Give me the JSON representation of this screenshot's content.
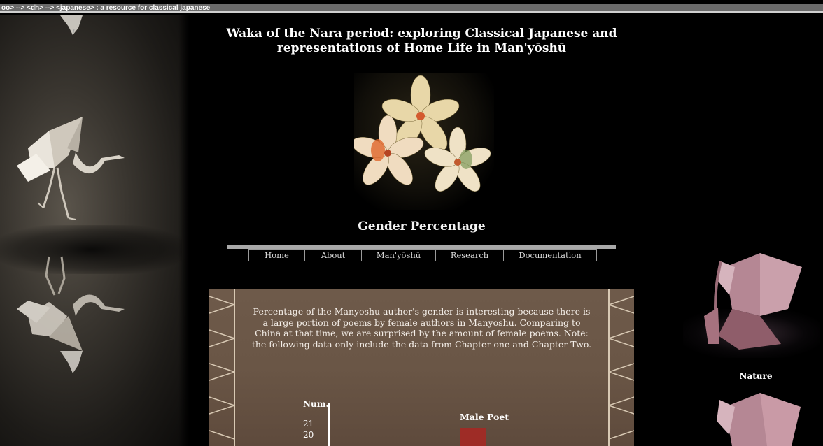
{
  "breadcrumb": "oo> --> <dh> --> <japanese> : a resource for classical japanese",
  "page_title": "Waka of the Nara period: exploring Classical Japanese and representations of Home Life in Man'yōshū",
  "section_title": "Gender Percentage",
  "nav": {
    "items": [
      {
        "label": "Home"
      },
      {
        "label": "About"
      },
      {
        "label": "Man'yōshū"
      },
      {
        "label": "Research"
      },
      {
        "label": "Documentation"
      }
    ]
  },
  "intro_text": "Percentage of the Manyoshu author's gender is interesting because there is a large portion of poems by female authors in Manyoshu. Comparing to China at that time, we are surprised by the amount of female poems. Note: the following data only include the data from Chapter one and Chapter Two.",
  "sidebar": {
    "nature_label": "Nature"
  },
  "chart_data": {
    "type": "bar",
    "ylabel": "Num.",
    "ticks": [
      "21",
      "20"
    ],
    "series": [
      {
        "name": "Male Poet",
        "color": "#9e2c26"
      }
    ]
  },
  "colors": {
    "background": "#000000",
    "panel": "#6a5646",
    "bar": "#9e2c26"
  }
}
